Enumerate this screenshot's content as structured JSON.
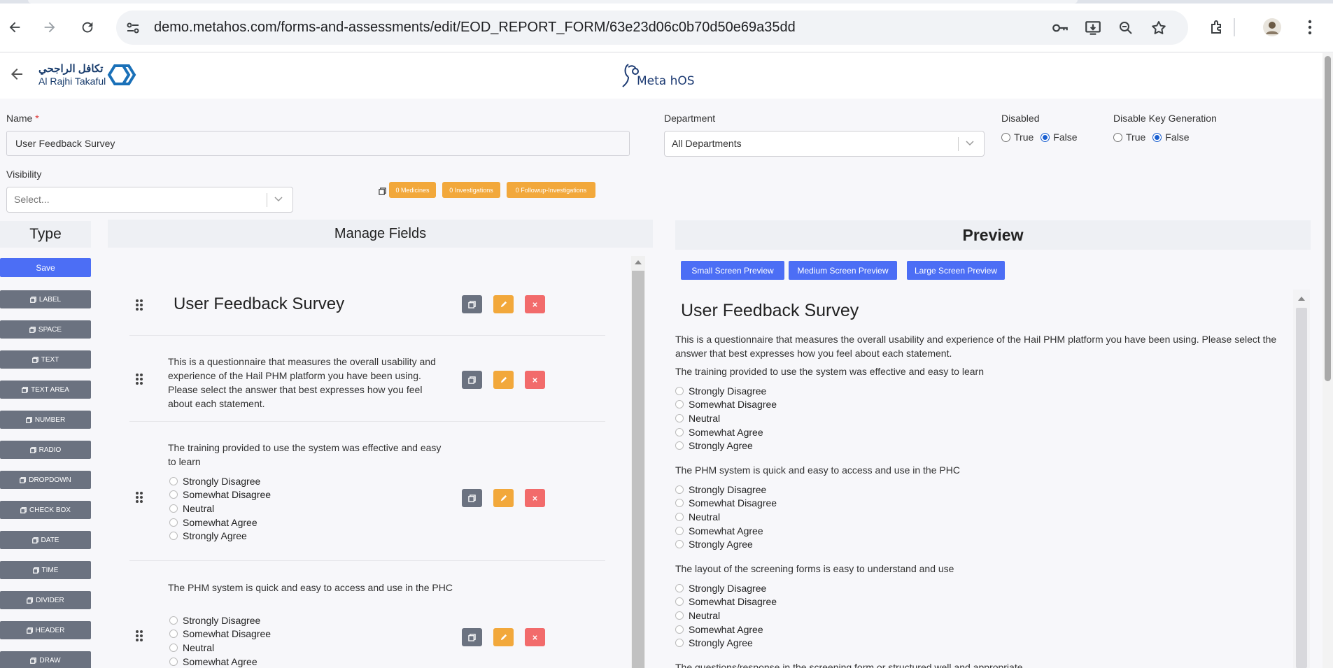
{
  "browser": {
    "url": "demo.metahos.com/forms-and-assessments/edit/EOD_REPORT_FORM/63e23d06c0b70d50e69a35dd"
  },
  "header": {
    "logo_arabic": "تكافل الراجحي",
    "logo_english": "Al Rajhi Takaful",
    "app_logo": "Meta hOS"
  },
  "form": {
    "name_label": "Name",
    "name_required": "*",
    "name_value": "User Feedback Survey",
    "department_label": "Department",
    "department_value": "All Departments",
    "disabled_label": "Disabled",
    "disabled_true": "True",
    "disabled_false": "False",
    "disable_key_label": "Disable Key Generation",
    "disable_key_true": "True",
    "disable_key_false": "False",
    "visibility_label": "Visibility",
    "visibility_placeholder": "Select..."
  },
  "chips": {
    "medicines": "0 Medicines",
    "investigations": "0 Investigations",
    "followup": "0 Followup-Investigations"
  },
  "types": {
    "heading": "Type",
    "save": "Save",
    "items": [
      "LABEL",
      "SPACE",
      "TEXT",
      "TEXT AREA",
      "NUMBER",
      "RADIO",
      "DROPDOWN",
      "CHECK BOX",
      "DATE",
      "TIME",
      "DIVIDER",
      "HEADER",
      "DRAW"
    ]
  },
  "manage": {
    "heading": "Manage Fields",
    "title": "User Feedback Survey",
    "description": "This is a questionnaire that measures the overall usability and experience of the Hail PHM platform you have been using. Please select the answer that best expresses how you feel about each statement.",
    "q1": "The training provided to use the system was effective and easy to learn",
    "q2": "The PHM system is quick and easy to access and use in the PHC",
    "q1_options": [
      "Strongly Disagree",
      "Somewhat Disagree",
      "Neutral",
      "Somewhat Agree",
      "Strongly Agree"
    ],
    "q2_options": [
      "Strongly Disagree",
      "Somewhat Disagree",
      "Neutral",
      "Somewhat Agree"
    ]
  },
  "preview": {
    "heading": "Preview",
    "small_btn": "Small Screen Preview",
    "medium_btn": "Medium Screen Preview",
    "large_btn": "Large Screen Preview",
    "title": "User Feedback Survey",
    "description": "This is a questionnaire that measures the overall usability and experience of the Hail PHM platform you have been using. Please select the answer that best expresses how you feel about each statement.",
    "q1": "The training provided to use the system was effective and easy to learn",
    "q2": "The PHM system is quick and easy to access and use in the PHC",
    "q3": "The layout of the screening forms is easy to understand and use",
    "q4": "The questions/response in the screening form or structured well and appropriate",
    "options": [
      "Strongly Disagree",
      "Somewhat Disagree",
      "Neutral",
      "Somewhat Agree",
      "Strongly Agree"
    ]
  },
  "colors": {
    "primary": "#4c6ef5",
    "chip": "#f2a83b",
    "delete": "#f26b6b",
    "type_button": "#6b7280"
  }
}
